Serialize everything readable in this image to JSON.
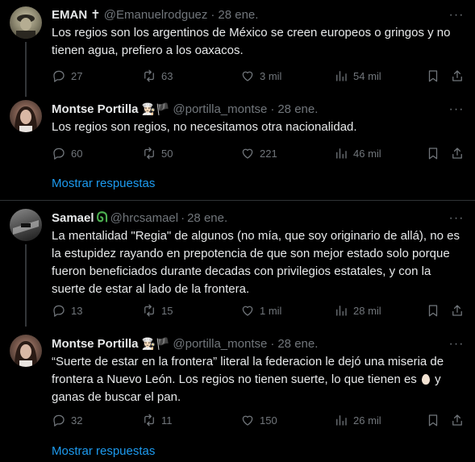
{
  "tweets": [
    {
      "name": "EMAN",
      "badge": "✝",
      "handle": "@Emanuelrodguez",
      "date": "28 ene.",
      "text": "Los regios son los argentinos de México se creen europeos o gringos y no tienen agua, prefiero a los oaxacos.",
      "replies": "27",
      "retweets": "63",
      "likes": "3 mil",
      "views": "54 mil"
    },
    {
      "name": "Montse Portilla",
      "badge": "👩🏻‍🍳🏴",
      "handle": "@portilla_montse",
      "date": "28 ene.",
      "text": "Los regios son regios, no necesitamos otra nacionalidad.",
      "replies": "60",
      "retweets": "50",
      "likes": "221",
      "views": "46 mil"
    },
    {
      "name": "Samael",
      "badge": "ᘏ",
      "handle": "@hrcsamael",
      "date": "28 ene.",
      "text": "La mentalidad \"Regia\" de algunos (no mía, que soy originario de allá), no es la estupidez rayando en prepotencia de que son mejor estado solo porque fueron beneficiados durante decadas con privilegios estatales, y con la suerte de estar al lado de la frontera.",
      "replies": "13",
      "retweets": "15",
      "likes": "1 mil",
      "views": "28 mil"
    },
    {
      "name": "Montse Portilla",
      "badge": "👩🏻‍🍳🏴",
      "handle": "@portilla_montse",
      "date": "28 ene.",
      "text_before": "“Suerte de estar en la frontera” literal la federacion le dejó una miseria de frontera a Nuevo León. Los regios no tienen suerte, lo que tienen es",
      "text_after": "y ganas de buscar el pan.",
      "replies": "32",
      "retweets": "11",
      "likes": "150",
      "views": "26 mil"
    }
  ],
  "show_replies_label": "Mostrar respuestas",
  "dot": "·",
  "more_label": "···",
  "colors": {
    "background": "#000000",
    "text": "#e7e9ea",
    "muted": "#71767b",
    "link": "#1d9bf0",
    "divider": "#2f3336"
  }
}
